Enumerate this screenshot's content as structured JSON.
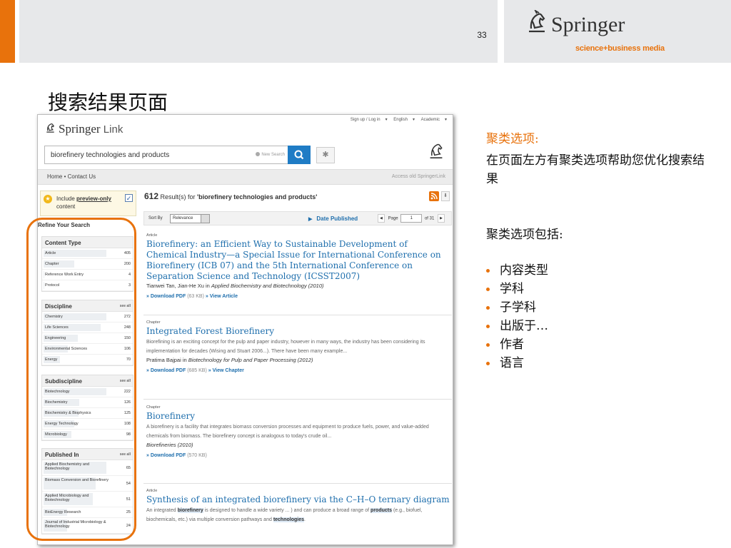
{
  "slide": {
    "number": "33",
    "title": "搜索结果页面",
    "logo_word": "Springer",
    "logo_tagline": "science+business media",
    "accent_color": "#e8720c"
  },
  "screenshot": {
    "topnav": [
      "Sign up / Log in",
      "English",
      "Academic"
    ],
    "logo_word": "Springer",
    "logo_link": "Link",
    "search_query": "biorefinery technologies and products",
    "new_search": "New Search",
    "nav_left": "Home  •  Contact Us",
    "nav_right": "Access old SpringerLink",
    "preview": {
      "prefix": "Include ",
      "link": "preview-only",
      "suffix": "content"
    },
    "refine_label": "Refine Your Search",
    "facets": [
      {
        "title": "Content Type",
        "see_all": "",
        "items": [
          {
            "label": "Article",
            "count": "405",
            "share": 1.0
          },
          {
            "label": "Chapter",
            "count": "200",
            "share": 0.49
          },
          {
            "label": "Reference Work Entry",
            "count": "4",
            "share": 0.01
          },
          {
            "label": "Protocol",
            "count": "3",
            "share": 0.01
          }
        ]
      },
      {
        "title": "Discipline",
        "see_all": "see all",
        "items": [
          {
            "label": "Chemistry",
            "count": "272",
            "share": 1.0
          },
          {
            "label": "Life Sciences",
            "count": "248",
            "share": 0.91
          },
          {
            "label": "Engineering",
            "count": "150",
            "share": 0.55
          },
          {
            "label": "Environmental Sciences",
            "count": "106",
            "share": 0.39
          },
          {
            "label": "Energy",
            "count": "70",
            "share": 0.26
          }
        ]
      },
      {
        "title": "Subdiscipline",
        "see_all": "see all",
        "items": [
          {
            "label": "Biotechnology",
            "count": "222",
            "share": 1.0
          },
          {
            "label": "Biochemistry",
            "count": "126",
            "share": 0.57
          },
          {
            "label": "Biochemistry & Biophysics",
            "count": "125",
            "share": 0.56
          },
          {
            "label": "Energy Technology",
            "count": "108",
            "share": 0.49
          },
          {
            "label": "Microbiology",
            "count": "98",
            "share": 0.44
          }
        ]
      },
      {
        "title": "Published In",
        "see_all": "see all",
        "items": [
          {
            "label": "Applied Biochemistry and Biotechnology",
            "count": "65",
            "share": 1.0
          },
          {
            "label": "Biomass Conversion and Biorefinery",
            "count": "54",
            "share": 0.83
          },
          {
            "label": "Applied Microbiology and Biotechnology",
            "count": "51",
            "share": 0.78
          },
          {
            "label": "BioEnergy Research",
            "count": "25",
            "share": 0.38
          },
          {
            "label": "Journal of Industrial Microbiology & Biotechnology",
            "count": "24",
            "share": 0.37
          }
        ]
      }
    ],
    "results_count": "612",
    "results_text": " Result(s) for ",
    "results_query": "'biorefinery technologies and products'",
    "sort_by": "Sort By",
    "sort_value": "Relevance",
    "date_published": "Date Published",
    "page_label": "Page",
    "page_value": "1",
    "page_total": "of 31",
    "results": [
      {
        "type": "Article",
        "title": "Biorefinery: an Efficient Way to Sustainable Development of Chemical Industry—a Special Issue for International Conference on Biorefinery (ICB 07) and the 5th International Conference on Separation Science and Technology (ICSST2007)",
        "desc": "",
        "author": "Tianwei Tan, Jian-He Xu in ",
        "source": "Applied Biochemistry and Biotechnology (2010)",
        "download": "» Download PDF",
        "size": "(63 KB)",
        "view": "» View Article"
      },
      {
        "type": "Chapter",
        "title": "Integrated Forest Biorefinery",
        "desc": "Biorefining is an exciting concept for the pulp and paper industry, however in many ways, the industry has been considering its implementation for decades (Wising and Stuart 2006...). There have been many example...",
        "author": "Pratima Bajpai in ",
        "source": "Biotechnology for Pulp and Paper Processing (2012)",
        "download": "» Download PDF",
        "size": "(685 KB)",
        "view": "» View Chapter"
      },
      {
        "type": "Chapter",
        "title": "Biorefinery",
        "desc": "A biorefinery is a facility that integrates biomass conversion processes and equipment to produce fuels, power, and value-added chemicals from biomass. The biorefinery concept is analogous to today's crude oil...",
        "author": "",
        "source": "Biorefineries (2010)",
        "download": "» Download PDF",
        "size": "(570 KB)",
        "view": ""
      },
      {
        "type": "Article",
        "title": "Synthesis of an integrated biorefinery via the C–H–O ternary diagram",
        "desc_parts": [
          "An integrated ",
          "biorefinery",
          " is designed to handle a wide variety ... ) and can produce a broad range of ",
          "products",
          " (e.g., biofuel, biochemicals, etc.) via multiple conversion pathways and ",
          "technologies",
          "."
        ]
      }
    ]
  },
  "panel": {
    "heading": "聚类选项:",
    "text": "在页面左方有聚类选项帮助您优化搜索结果",
    "sub": "聚类选项包括:",
    "items": [
      "内容类型",
      "学科",
      "子学科",
      "出版于…",
      "作者",
      "语言"
    ]
  }
}
